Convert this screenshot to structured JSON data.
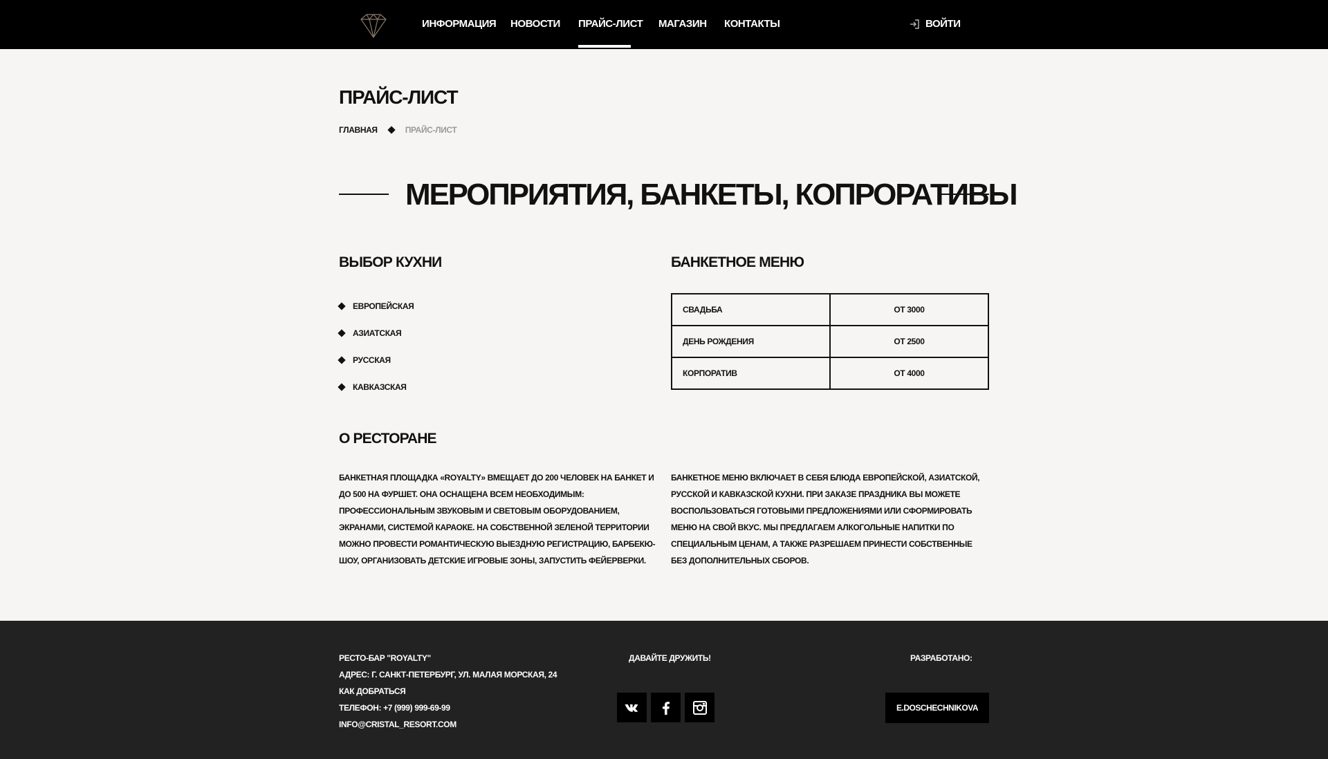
{
  "header": {
    "nav": [
      {
        "label": "ИНФОРМАЦИЯ"
      },
      {
        "label": "НОВОСТИ"
      },
      {
        "label": "ПРАЙС-ЛИСТ",
        "active": true
      },
      {
        "label": "МАГАЗИН"
      },
      {
        "label": "КОНТАКТЫ"
      }
    ],
    "login_label": "ВОЙТИ",
    "logo_icon": "diamond-logo-icon",
    "login_icon": "sign-in-icon"
  },
  "page": {
    "title": "ПРАЙС-ЛИСТ",
    "breadcrumb": {
      "home": "ГЛАВНАЯ",
      "current": "ПРАЙС-ЛИСТ"
    },
    "section_title": "МЕРОПРИЯТИЯ, БАНКЕТЫ, КОПРОРАТИВЫ"
  },
  "cuisine": {
    "heading": "ВЫБОР КУХНИ",
    "items": [
      "ЕВРОПЕЙСКАЯ",
      "АЗИАТСКАЯ",
      "РУССКАЯ",
      "КАВКАЗСКАЯ"
    ]
  },
  "banquet_menu": {
    "heading": "БАНКЕТНОЕ МЕНЮ",
    "rows": [
      {
        "name": "СВАДЬБА",
        "price": "ОТ 3000"
      },
      {
        "name": "ДЕНЬ РОЖДЕНИЯ",
        "price": "ОТ 2500"
      },
      {
        "name": "КОРПОРАТИВ",
        "price": "ОТ 4000"
      }
    ]
  },
  "about": {
    "heading": "О РЕСТОРАНЕ",
    "left_text": "БАНКЕТНАЯ ПЛОЩАДКА «ROYALTY» ВМЕЩАЕТ ДО 200 ЧЕЛОВЕК НА БАНКЕТ И ДО 500 НА ФУРШЕТ. ОНА ОСНАЩЕНА ВСЕМ НЕОБХОДИМЫМ: ПРОФЕССИОНАЛЬНЫМ ЗВУКОВЫМ И СВЕТОВЫМ ОБОРУДОВАНИЕМ, ЭКРАНАМИ, СИСТЕМОЙ КАРАОКЕ. НА СОБСТВЕННОЙ ЗЕЛЕНОЙ ТЕРРИТОРИИ МОЖНО ПРОВЕСТИ РОМАНТИЧЕСКУЮ ВЫЕЗДНУЮ РЕГИСТРАЦИЮ, БАРБЕКЮ-ШОУ, ОРГАНИЗОВАТЬ ДЕТСКИЕ ИГРОВЫЕ ЗОНЫ, ЗАПУСТИТЬ ФЕЙЕРВЕРКИ.",
    "right_text": "БАНКЕТНОЕ МЕНЮ ВКЛЮЧАЕТ В СЕБЯ БЛЮДА ЕВРОПЕЙСКОЙ, АЗИАТСКОЙ, РУССКОЙ И КАВКАЗСКОЙ КУХНИ. ПРИ ЗАКАЗЕ ПРАЗДНИКА ВЫ МОЖЕТЕ ВОСПОЛЬЗОВАТЬСЯ ГОТОВЫМИ ПРЕДЛОЖЕНИЯМИ ИЛИ СФОРМИРОВАТЬ МЕНЮ НА СВОЙ ВКУС. МЫ ПРЕДЛАГАЕМ АЛКОГОЛЬНЫЕ НАПИТКИ ПО СПЕЦИАЛЬНЫМ ЦЕНАМ, А ТАКЖЕ РАЗРЕШАЕМ ПРИНЕСТИ СОБСТВЕННЫЕ БЕЗ ДОПОЛНИТЕЛЬНЫХ СБОРОВ."
  },
  "footer": {
    "name": "РЕСТО-БАР \"ROYALTY\"",
    "address": "АДРЕС: Г. САНКТ-ПЕТЕРБУРГ, УЛ. МАЛАЯ МОРСКАЯ, 24",
    "directions": "КАК ДОБРАТЬСЯ",
    "phone": "ТЕЛЕФОН: +7 (999) 999-69-99",
    "email": "INFO@CRISTAL_RESORT.COM",
    "friends_title": "ДАВАЙТЕ ДРУЖИТЬ!",
    "socials": [
      "vk-icon",
      "facebook-icon",
      "instagram-icon"
    ],
    "developed_title": "РАЗРАБОТАНО:",
    "developer": "E.DOSCHECHNIKOVA"
  },
  "colors": {
    "header_bg": "#000000",
    "page_bg": "#f7f5f3",
    "footer_bg": "#222222",
    "breadcrumb_current": "#999999"
  }
}
